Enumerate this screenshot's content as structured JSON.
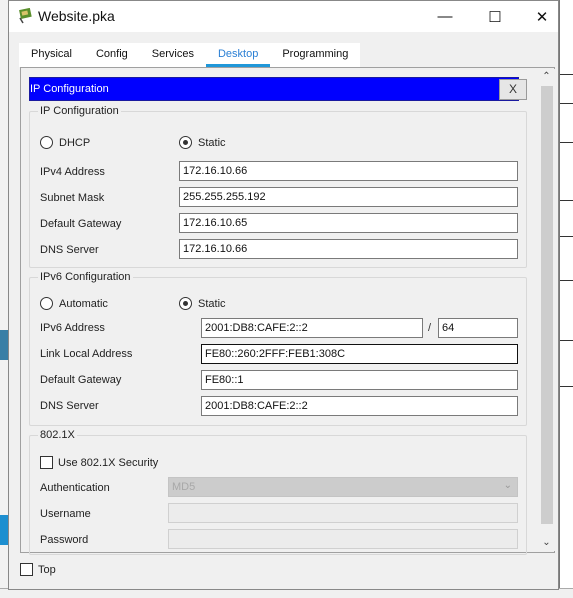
{
  "window": {
    "title": "Website.pka",
    "controls": {
      "minimize": "—",
      "maximize": "☐",
      "close": "✕"
    }
  },
  "tabs": [
    {
      "label": "Physical",
      "active": false
    },
    {
      "label": "Config",
      "active": false
    },
    {
      "label": "Services",
      "active": false
    },
    {
      "label": "Desktop",
      "active": true
    },
    {
      "label": "Programming",
      "active": false
    }
  ],
  "panel": {
    "title": "IP Configuration",
    "close_label": "X",
    "colors": {
      "header_bg": "#0000ff",
      "tab_accent": "#1f97d9"
    }
  },
  "ipv4": {
    "group_title": "IP Configuration",
    "mode_options": [
      {
        "label": "DHCP",
        "selected": false
      },
      {
        "label": "Static",
        "selected": true
      }
    ],
    "fields": [
      {
        "label": "IPv4 Address",
        "value": "172.16.10.66"
      },
      {
        "label": "Subnet Mask",
        "value": "255.255.255.192"
      },
      {
        "label": "Default Gateway",
        "value": "172.16.10.65"
      },
      {
        "label": "DNS Server",
        "value": "172.16.10.66"
      }
    ]
  },
  "ipv6": {
    "group_title": "IPv6 Configuration",
    "mode_options": [
      {
        "label": "Automatic",
        "selected": false
      },
      {
        "label": "Static",
        "selected": true
      }
    ],
    "address_label": "IPv6 Address",
    "address_value": "2001:DB8:CAFE:2::2",
    "prefix_separator": "/",
    "prefix_value": "64",
    "link_local_label": "Link Local Address",
    "link_local_value": "FE80::260:2FFF:FEB1:308C",
    "gateway_label": "Default Gateway",
    "gateway_value": "FE80::1",
    "dns_label": "DNS Server",
    "dns_value": "2001:DB8:CAFE:2::2"
  },
  "dot1x": {
    "group_title": "802.1X",
    "use_security_label": "Use 802.1X Security",
    "use_security_checked": false,
    "authentication_label": "Authentication",
    "authentication_value": "MD5",
    "username_label": "Username",
    "username_value": "",
    "password_label": "Password",
    "password_value": ""
  },
  "footer": {
    "top_label": "Top",
    "top_checked": false
  },
  "scrollbar": {
    "up": "⌃",
    "down": "⌄"
  }
}
